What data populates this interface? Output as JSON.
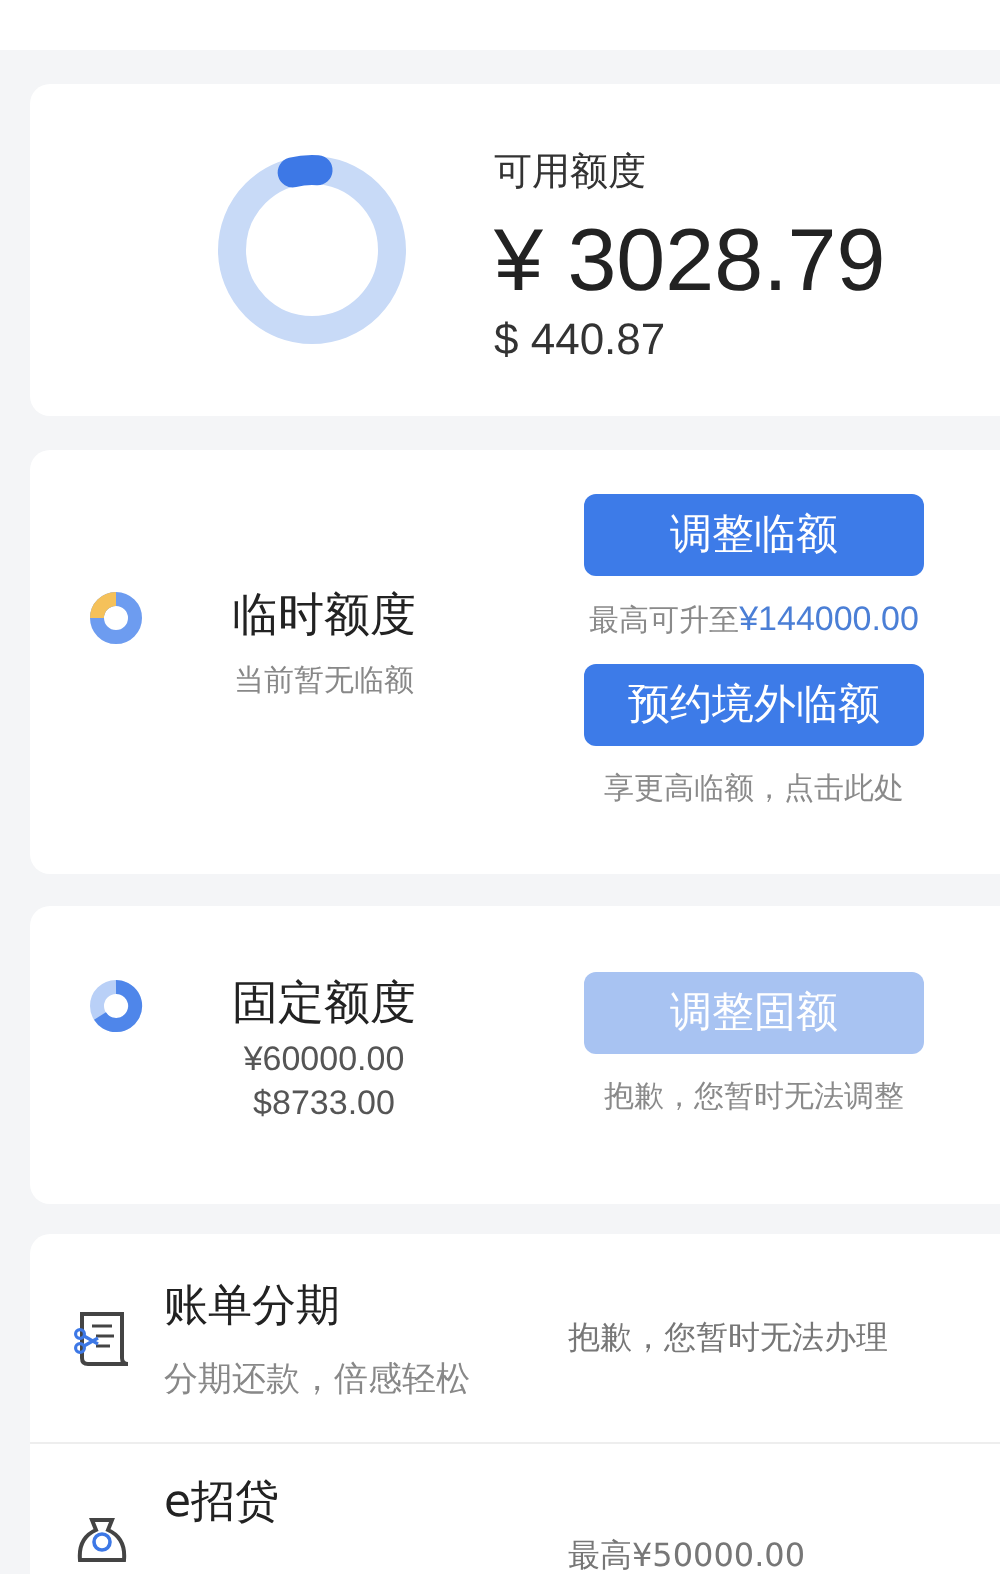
{
  "available": {
    "label": "可用额度",
    "level": 0.05,
    "cny": "¥ 3028.79",
    "usd": "$ 440.87"
  },
  "temporary": {
    "title": "临时额度",
    "subtitle": "当前暂无临额",
    "actions": [
      {
        "button": "调整临额",
        "disabled": false,
        "hint": "最高可升至",
        "hint_amount": "¥144000.00"
      },
      {
        "button": "预约境外临额",
        "disabled": false,
        "hint": "享更高临额，点击此处"
      }
    ]
  },
  "fixed": {
    "title": "固定额度",
    "amounts": [
      "¥60000.00",
      "$8733.00"
    ],
    "actions": [
      {
        "button": "调整固额",
        "disabled": true,
        "hint": "抱歉，您暂时无法调整"
      }
    ]
  },
  "services": [
    {
      "kind": "installment",
      "title": "账单分期",
      "subtitle": "分期还款，倍感轻松",
      "status": "抱歉，您暂时无法办理"
    },
    {
      "kind": "loan",
      "title": "e招贷",
      "status": "最高¥50000.00"
    }
  ]
}
